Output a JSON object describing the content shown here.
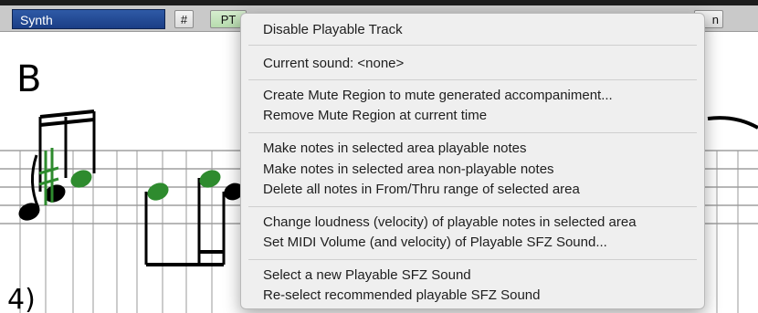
{
  "toolbar": {
    "track_name": "Synth",
    "sharp_label": "#",
    "pt_label": "PT",
    "right_label": "n"
  },
  "notation": {
    "chord_symbol": "B",
    "bar_number": "4)"
  },
  "context_menu": {
    "disable_playable_track": "Disable Playable Track",
    "current_sound": "Current sound: <none>",
    "create_mute_region": "Create Mute Region to mute generated accompaniment...",
    "remove_mute_region": "Remove Mute Region at current time",
    "make_playable": "Make notes in selected area playable notes",
    "make_non_playable": "Make notes in selected area non-playable notes",
    "delete_notes": "Delete all notes in From/Thru range of selected area",
    "change_loudness": "Change loudness (velocity) of playable notes in selected area",
    "set_midi_volume": "Set MIDI Volume (and velocity) of Playable SFZ Sound...",
    "select_new_sfz": "Select a new Playable SFZ Sound",
    "reselect_sfz": "Re-select recommended playable SFZ Sound"
  },
  "colors": {
    "track_name_bg": "#1b3e86",
    "playable_note": "#2e8b2e",
    "note": "#000000"
  }
}
